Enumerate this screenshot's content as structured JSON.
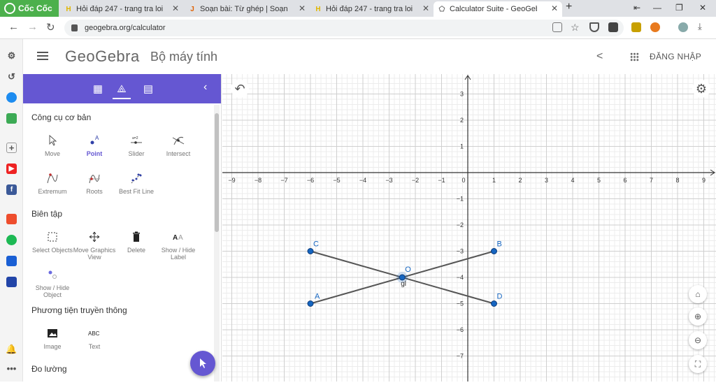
{
  "browser": {
    "brand": "Cốc Cốc",
    "tabs": [
      {
        "title": "Hỏi đáp 247 - trang tra loi",
        "fav": "H",
        "color": "#e0b600"
      },
      {
        "title": "Soạn bài: Từ ghép | Soạn văn",
        "fav": "J",
        "color": "#e06000"
      },
      {
        "title": "Hỏi đáp 247 - trang tra loi",
        "fav": "H",
        "color": "#e0b600"
      },
      {
        "title": "Calculator Suite - GeoGebra",
        "fav": "⬠",
        "color": "#666"
      }
    ],
    "new_tab": "+",
    "url": "geogebra.org/calculator"
  },
  "app": {
    "logo": "GeoGebra",
    "title": "Bộ máy tính",
    "login": "ĐĂNG NHẬP"
  },
  "panel": {
    "sections": [
      {
        "title": "Công cụ cơ bản",
        "tools": [
          "Move",
          "Point",
          "Slider",
          "Intersect",
          "Extremum",
          "Roots",
          "Best Fit Line"
        ]
      },
      {
        "title": "Biên tập",
        "tools": [
          "Select Objects",
          "Move Graphics View",
          "Delete",
          "Show / Hide Label",
          "Show / Hide Object"
        ]
      },
      {
        "title": "Phương tiện truyền thông",
        "tools": [
          "Image",
          "Text"
        ]
      },
      {
        "title": "Đo lường",
        "tools": []
      }
    ],
    "selected_tool": "Point",
    "accent": "#6557d2"
  },
  "chart_data": {
    "type": "scatter",
    "xlim": [
      -9,
      9
    ],
    "ylim": [
      -7,
      3
    ],
    "x_ticks": [
      -9,
      -8,
      -7,
      -6,
      -5,
      -4,
      -3,
      -2,
      -1,
      0,
      1,
      2,
      3,
      4,
      5,
      6,
      7,
      8,
      9
    ],
    "y_ticks": [
      -7,
      -6,
      -5,
      -4,
      -3,
      -2,
      -1,
      1,
      2,
      3
    ],
    "grid": true,
    "points": [
      {
        "label": "A",
        "x": -6,
        "y": -5
      },
      {
        "label": "B",
        "x": 1,
        "y": -3
      },
      {
        "label": "C",
        "x": -6,
        "y": -3
      },
      {
        "label": "D",
        "x": 1,
        "y": -5
      },
      {
        "label": "O",
        "x": -2.5,
        "y": -4
      }
    ],
    "segments": [
      [
        "A",
        "B"
      ],
      [
        "C",
        "D"
      ]
    ],
    "annotation": "gl"
  }
}
